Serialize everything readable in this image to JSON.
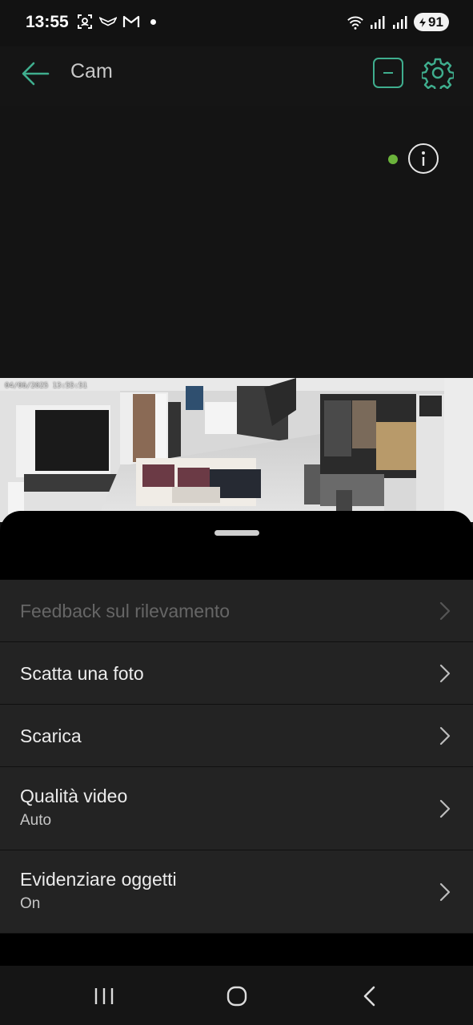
{
  "status_bar": {
    "time": "13:55",
    "battery": "91",
    "icons_left": [
      "face-scan-icon",
      "bird-icon",
      "gmail-icon",
      "dot-icon"
    ],
    "icons_right": [
      "wifi-icon",
      "signal-icon",
      "signal-icon",
      "battery-icon"
    ]
  },
  "app_bar": {
    "title": "Cam",
    "back_icon": "arrow-left-icon",
    "actions": [
      "minus-box-icon",
      "gear-icon"
    ],
    "accent_color": "#3fae8e"
  },
  "video": {
    "timestamp": "04/06/2025 13:55:51",
    "status_dot_color": "#6bb33b",
    "info_icon": "info-icon"
  },
  "sheet": {
    "items": [
      {
        "label": "Feedback sul rilevamento",
        "sub": "",
        "enabled": false
      },
      {
        "label": "Scatta una foto",
        "sub": ""
      },
      {
        "label": "Scarica",
        "sub": ""
      },
      {
        "label": "Qualità video",
        "sub": "Auto"
      },
      {
        "label": "Evidenziare oggetti",
        "sub": "On"
      }
    ]
  },
  "nav_bar": {
    "buttons": [
      "recents-icon",
      "home-icon",
      "back-icon"
    ]
  }
}
